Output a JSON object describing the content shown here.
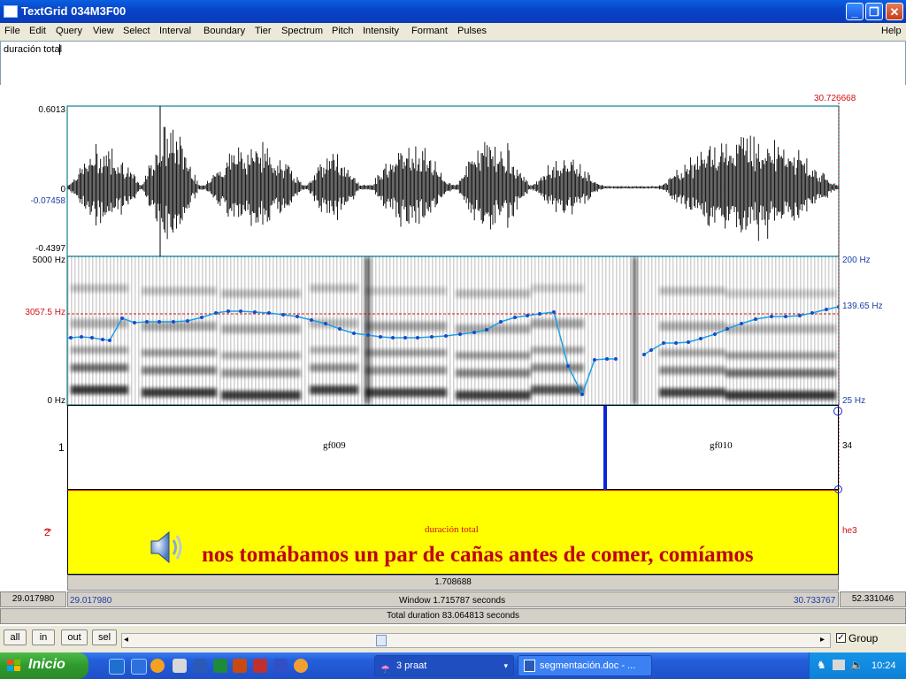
{
  "window": {
    "title": "TextGrid 034M3F00",
    "btn_min": "_",
    "btn_max": "❐",
    "btn_close": "✕"
  },
  "menu": [
    "File",
    "Edit",
    "Query",
    "View",
    "Select",
    "Interval",
    "Boundary",
    "Tier",
    "Spectrum",
    "Pitch",
    "Intensity",
    "Formant",
    "Pulses"
  ],
  "menu_help": "Help",
  "textfield": {
    "value": "duración total"
  },
  "waveform": {
    "y_max": "0.6013",
    "y_zero": "0",
    "y_cursor": "-0.07458",
    "y_min": "-0.4397",
    "cursor_time": "30.726668"
  },
  "spectrogram": {
    "top_hz": "5000 Hz",
    "cursor_hz": "3057.5 Hz",
    "bottom_hz": "0 Hz",
    "pitch_top": "200 Hz",
    "pitch_cursor": "139.65 Hz",
    "pitch_bottom": "25 Hz"
  },
  "tiers": [
    {
      "number": "1",
      "right_count": "34",
      "intervals": [
        "gf009",
        "gf010"
      ]
    },
    {
      "number": "2",
      "right_name": "he3",
      "label": "duración total",
      "transcript": "nos tomábamos un par de cañas antes de comer, comíamos"
    }
  ],
  "time_rows": {
    "selection_duration": "1.708688",
    "left_total": "29.017980",
    "left_window": "29.017980",
    "window_text": "Window 1.715787 seconds",
    "right_window": "30.733767",
    "right_total": "52.331046",
    "total_text": "Total duration 83.064813 seconds"
  },
  "controls": {
    "all": "all",
    "in": "in",
    "out": "out",
    "sel": "sel",
    "group_label": "Group",
    "group_checked": true
  },
  "taskbar": {
    "start": "Inicio",
    "task1": "3 praat",
    "task2": "segmentación.doc - ...",
    "clock": "10:24"
  },
  "colors": {
    "cursor_red": "#d01010",
    "pitch_blue": "#1aa0e6",
    "tier_yellow": "#ffff00",
    "boundary_blue": "#0a28d6"
  }
}
